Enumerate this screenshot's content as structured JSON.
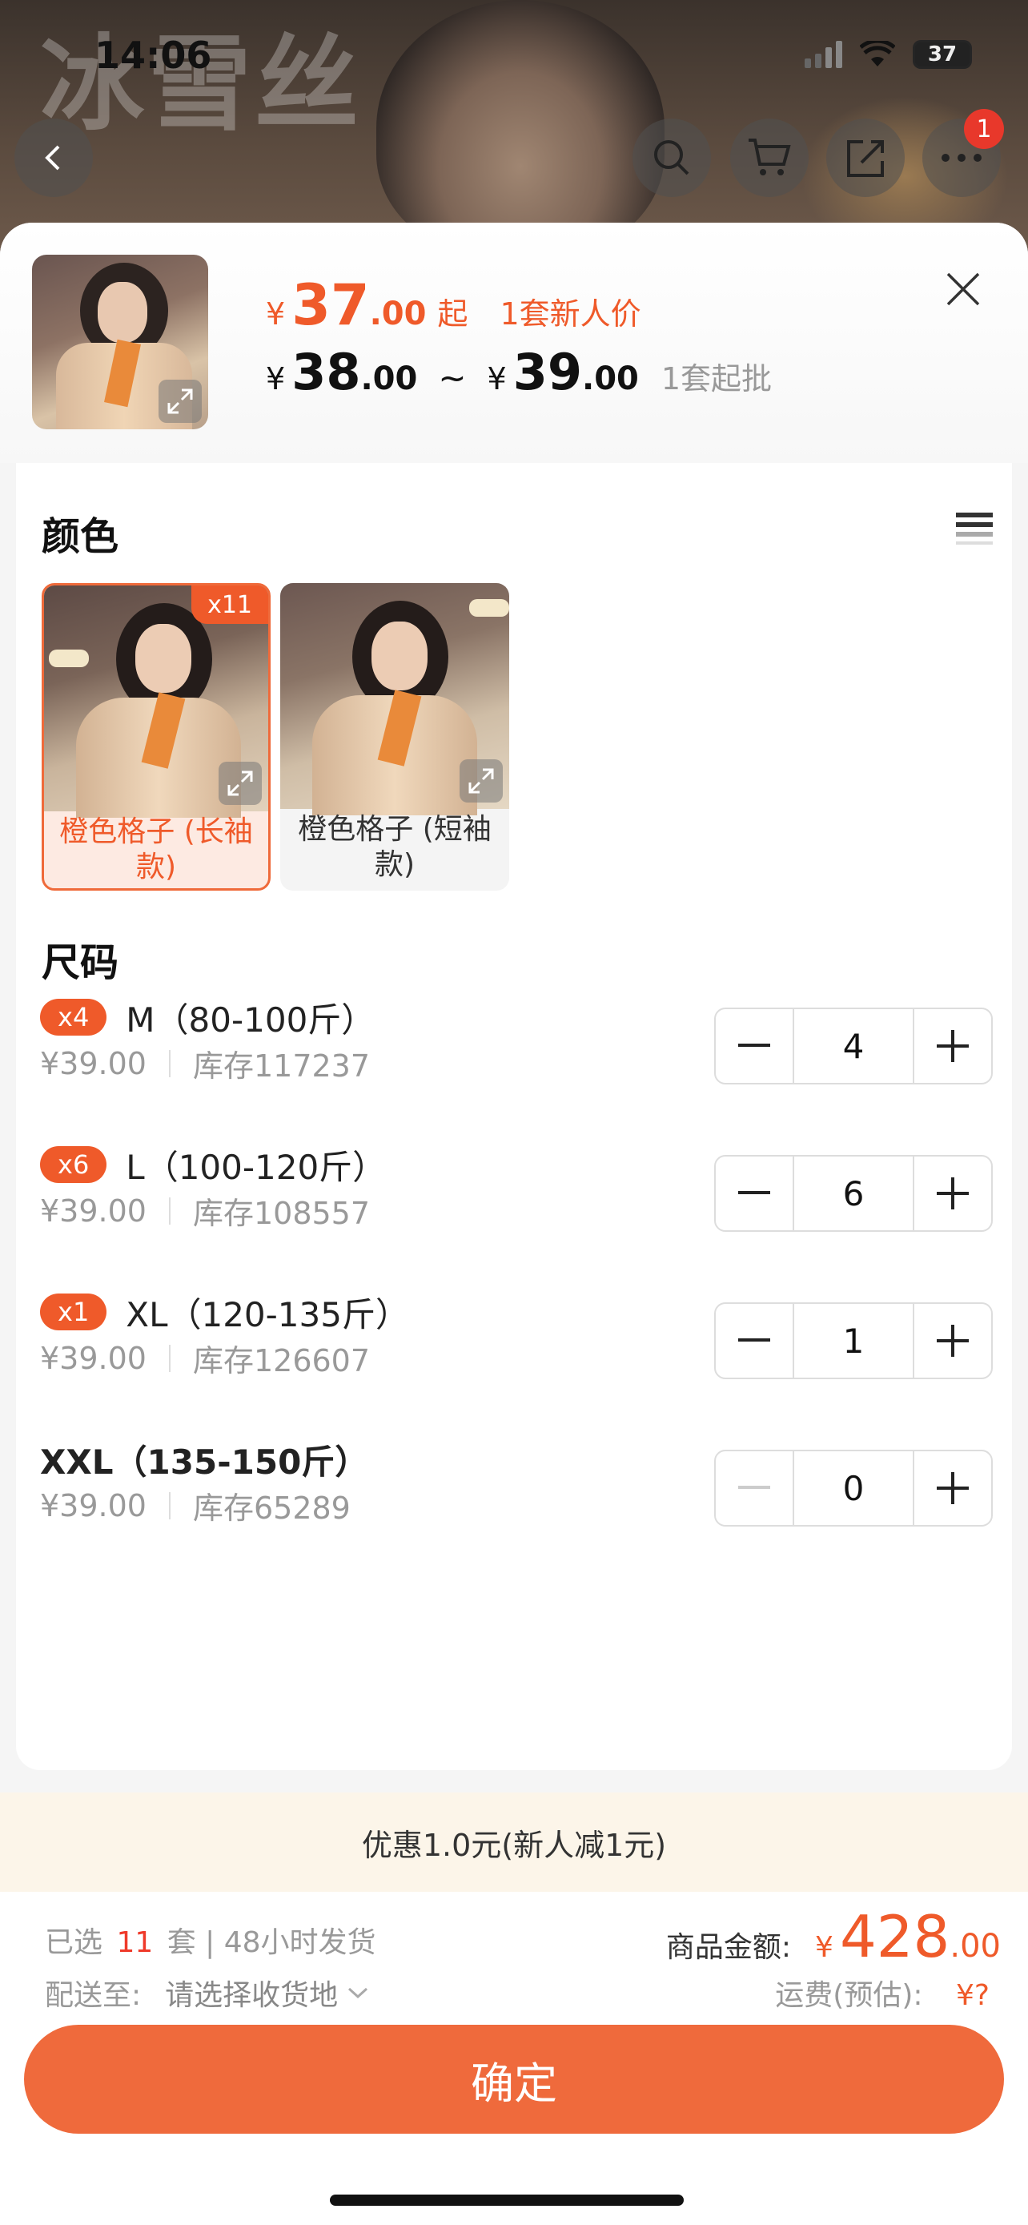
{
  "status_bar": {
    "time": "14:06",
    "battery": "37"
  },
  "hero": {
    "brand_text": "冰雪丝",
    "cart_badge": "1"
  },
  "icons": [
    "back-icon",
    "search-icon",
    "cart-icon",
    "share-icon",
    "more-icon",
    "close-icon",
    "expand-icon",
    "list-view-icon",
    "minus-icon",
    "plus-icon",
    "chevron-down-icon"
  ],
  "product": {
    "price_yen": "¥",
    "new_price_int": "37",
    "new_price_dec": ".00",
    "new_price_suffix": "起",
    "new_price_tag": "1套新人价",
    "range_low_int": "38",
    "range_low_dec": ".00",
    "range_sep": "~",
    "range_high_int": "39",
    "range_high_dec": ".00",
    "min_order": "1套起批"
  },
  "color_section": {
    "title": "颜色",
    "options": [
      {
        "label": "橙色格子 (长袖款)",
        "badge": "x11",
        "selected": true
      },
      {
        "label": "橙色格子 (短袖款)",
        "badge": "",
        "selected": false
      }
    ]
  },
  "size_section": {
    "title": "尺码",
    "rows": [
      {
        "badge": "x4",
        "name": "M（80-100斤）",
        "price": "¥39.00",
        "stock": "库存117237",
        "qty": "4"
      },
      {
        "badge": "x6",
        "name": "L（100-120斤）",
        "price": "¥39.00",
        "stock": "库存108557",
        "qty": "6"
      },
      {
        "badge": "x1",
        "name": "XL（120-135斤）",
        "price": "¥39.00",
        "stock": "库存126607",
        "qty": "1"
      },
      {
        "badge": "",
        "name": "XXL（135-150斤）",
        "price": "¥39.00",
        "stock": "库存65289",
        "qty": "0"
      }
    ]
  },
  "promo": {
    "text": "优惠1.0元(新人减1元)"
  },
  "summary": {
    "selected_prefix": "已选",
    "selected_count": "11",
    "selected_suffix": "套 | 48小时发货",
    "amount_label": "商品金额:",
    "amount_yen": "¥",
    "amount_int": "428",
    "amount_dec": ".00",
    "ship_label": "配送至:",
    "ship_dest": "请选择收货地",
    "freight_label": "运费(预估):",
    "freight_value": "¥?"
  },
  "confirm_button": "确定",
  "colors": {
    "accent": "#ef5a2a",
    "button": "#ef6a3c",
    "promo_bg": "#fcf5e9"
  }
}
